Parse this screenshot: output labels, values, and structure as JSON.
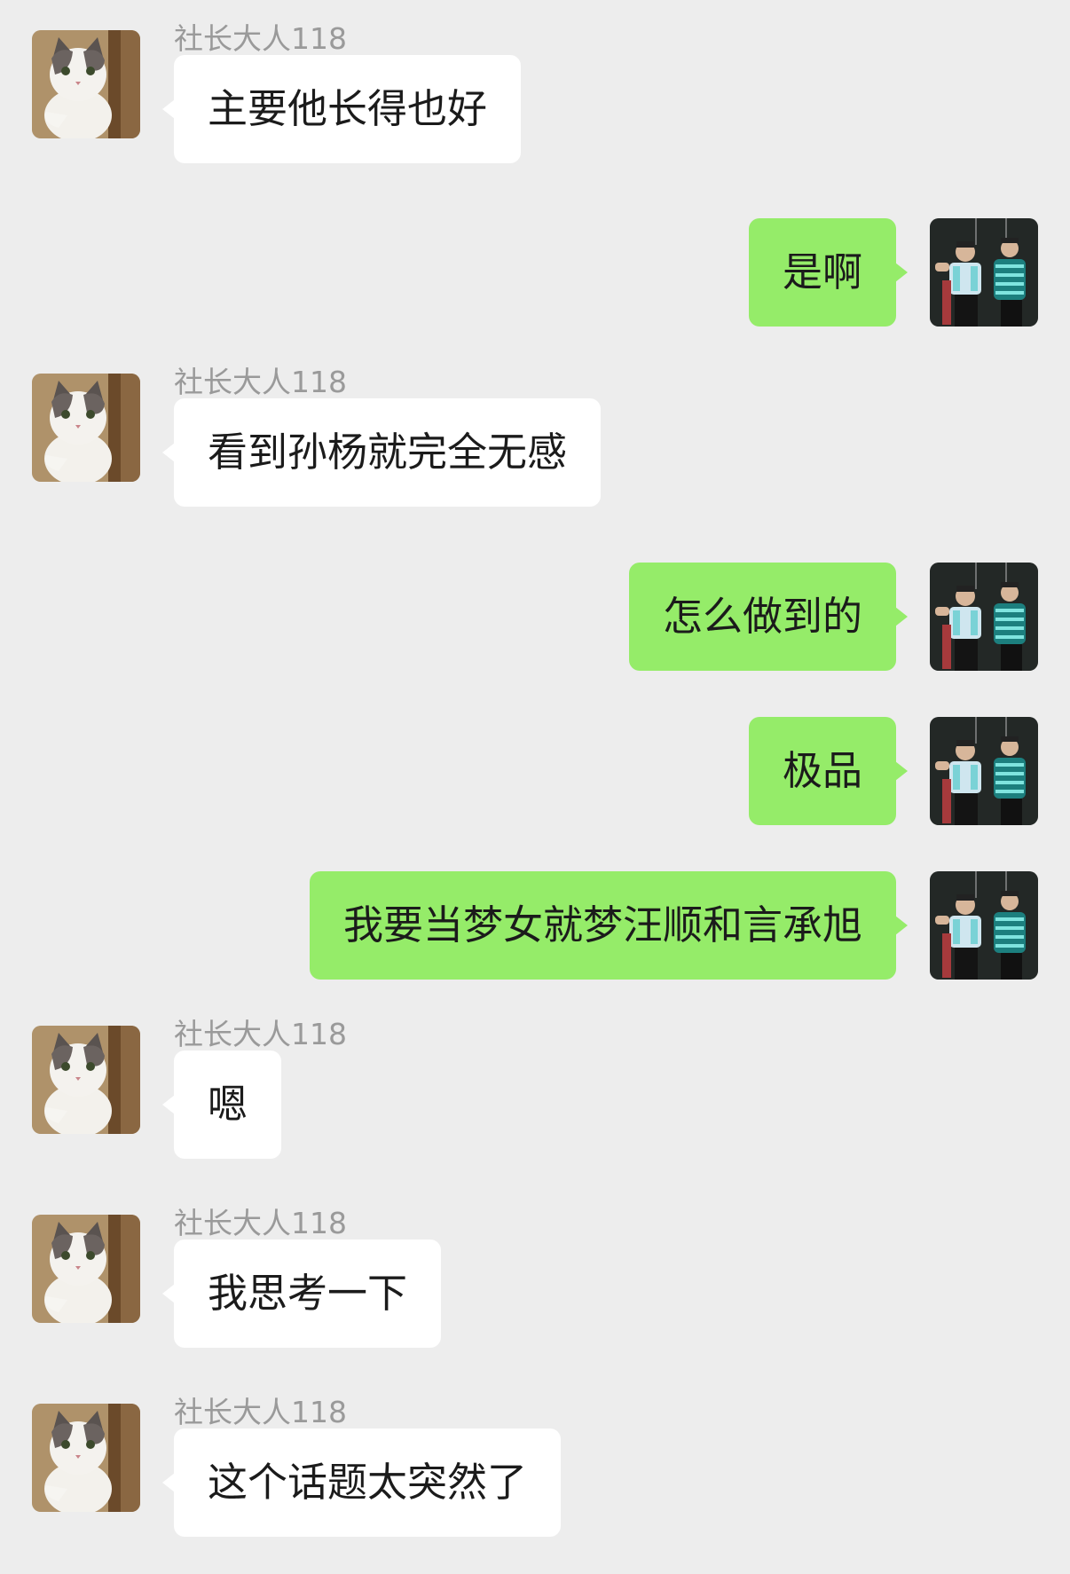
{
  "contact": {
    "name": "社长大人118",
    "avatar_icon": "cat-avatar-icon"
  },
  "me": {
    "avatar_icon": "children-photo-avatar-icon"
  },
  "colors": {
    "background": "#ededed",
    "incoming_bubble": "#ffffff",
    "outgoing_bubble": "#95ec69",
    "sender_text": "#9a9a9a"
  },
  "messages": [
    {
      "direction": "in",
      "sender": "社长大人118",
      "text": "主要他长得也好"
    },
    {
      "direction": "out",
      "text": "是啊"
    },
    {
      "direction": "in",
      "sender": "社长大人118",
      "text": "看到孙杨就完全无感"
    },
    {
      "direction": "out",
      "text": "怎么做到的"
    },
    {
      "direction": "out",
      "text": "极品"
    },
    {
      "direction": "out",
      "text": "我要当梦女就梦汪顺和言承旭"
    },
    {
      "direction": "in",
      "sender": "社长大人118",
      "text": "嗯"
    },
    {
      "direction": "in",
      "sender": "社长大人118",
      "text": "我思考一下"
    },
    {
      "direction": "in",
      "sender": "社长大人118",
      "text": "这个话题太突然了"
    }
  ]
}
